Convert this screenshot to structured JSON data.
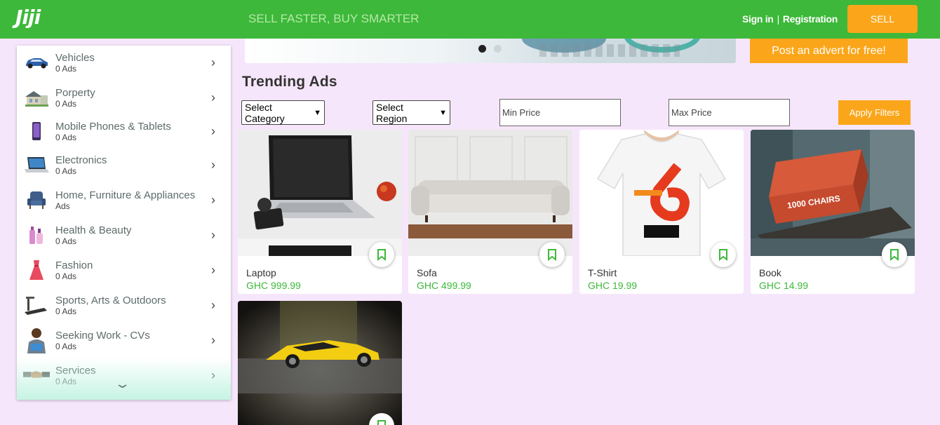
{
  "header": {
    "logo": "Jiji",
    "tagline": "SELL FASTER, BUY SMARTER",
    "sign_in": "Sign in",
    "separator": "|",
    "registration": "Registration",
    "sell_label": "SELL"
  },
  "banner": {
    "post_advert_label": "Post an advert for free!"
  },
  "sidebar": {
    "items": [
      {
        "label": "Vehicles",
        "count": "0 Ads",
        "icon": "car-icon"
      },
      {
        "label": "Porperty",
        "count": "0 Ads",
        "icon": "house-icon"
      },
      {
        "label": "Mobile Phones & Tablets",
        "count": "0 Ads",
        "icon": "phone-icon"
      },
      {
        "label": "Electronics",
        "count": "0 Ads",
        "icon": "laptop-icon"
      },
      {
        "label": "Home, Furniture & Appliances",
        "count": "Ads",
        "icon": "armchair-icon"
      },
      {
        "label": "Health & Beauty",
        "count": "0 Ads",
        "icon": "cosmetics-icon"
      },
      {
        "label": "Fashion",
        "count": "0 Ads",
        "icon": "dress-icon"
      },
      {
        "label": "Sports, Arts & Outdoors",
        "count": "0 Ads",
        "icon": "treadmill-icon"
      },
      {
        "label": "Seeking Work - CVs",
        "count": "0 Ads",
        "icon": "person-icon"
      },
      {
        "label": "Services",
        "count": "0 Ads",
        "icon": "handshake-icon"
      }
    ],
    "chevron": "›",
    "collapse": "⌄"
  },
  "main": {
    "title": "Trending Ads",
    "filters": {
      "category": "Select Category",
      "region": "Select Region",
      "min_price_placeholder": "Min Price",
      "max_price_placeholder": "Max Price",
      "apply_label": "Apply Filters"
    },
    "ads": [
      {
        "name": "Laptop",
        "price": "GHC 999.99"
      },
      {
        "name": "Sofa",
        "price": "GHC 499.99"
      },
      {
        "name": "T-Shirt",
        "price": "GHC 19.99"
      },
      {
        "name": "Book",
        "price": "GHC 14.99",
        "book_title": "1000 CHAIRS"
      },
      {
        "name": "",
        "price": ""
      }
    ]
  },
  "colors": {
    "brand_green": "#3db83a",
    "accent_orange": "#fba61a",
    "page_bg": "#f6e6fb"
  }
}
